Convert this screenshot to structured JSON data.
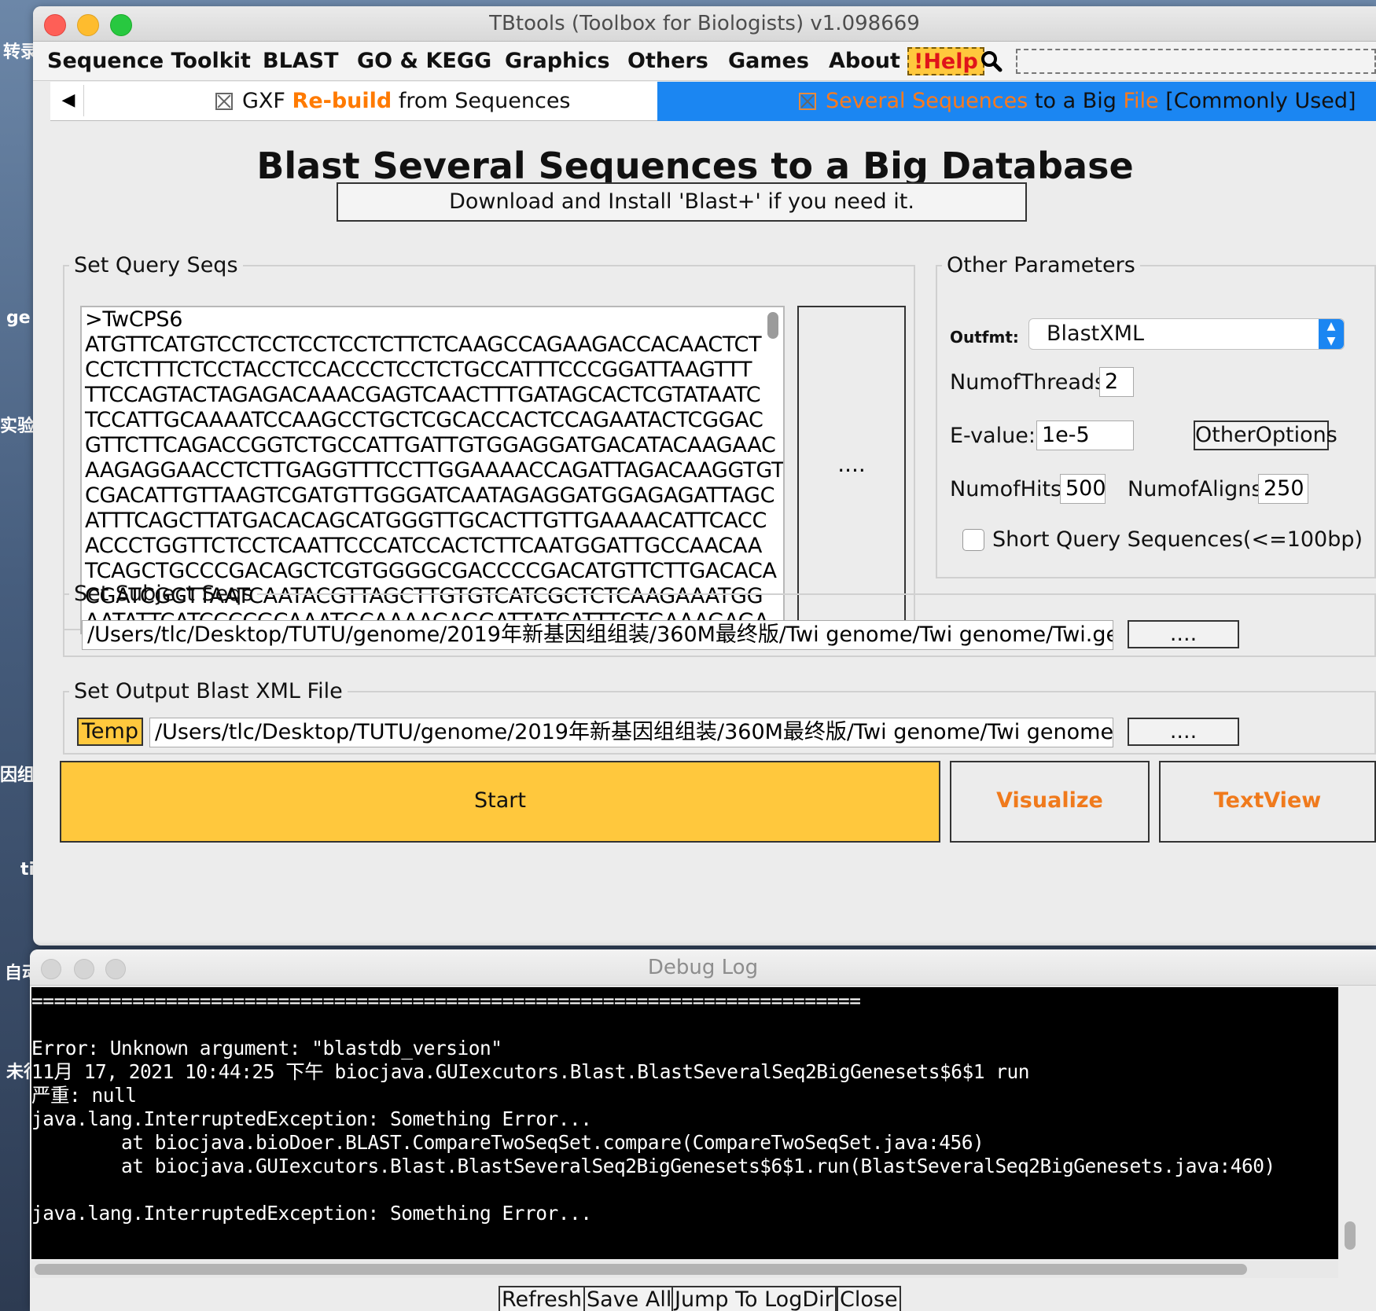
{
  "desktop": {
    "left_labels": [
      "转录",
      "ge",
      "实验",
      "因组",
      "ti",
      "自动",
      "未行"
    ]
  },
  "window": {
    "title": "TBtools (Toolbox for Biologists) v1.098669"
  },
  "menu": {
    "items": [
      "Sequence Toolkit",
      "BLAST",
      "GO & KEGG",
      "Graphics",
      "Others",
      "Games",
      "About"
    ],
    "help": "!Help"
  },
  "tabs": {
    "left": {
      "prefix": "GXF ",
      "highlight": "Re-build",
      "suffix": " from Sequences"
    },
    "right": {
      "part1": "Several Sequences",
      "part2": " to a Big ",
      "part3": "File",
      "part4": " [Commonly Used]"
    }
  },
  "main": {
    "title": "Blast Several Sequences to a Big Database",
    "download_button": "Download and Install 'Blast+' if you need it."
  },
  "query": {
    "legend": "Set Query Seqs",
    "lines": [
      ">TwCPS6",
      "ATGTTCATGTCCTCCTCCTCCTCTTCTCAAGCCAGAAGACCACAACTCT",
      "CCTCTTTCTCCTACCTCCACCCTCCTCTGCCATTTCCCGGATTAAGTTT",
      "TTCCAGTACTAGAGACAAACGAGTCAACTTTGATAGCACTCGTATAATC",
      "TCCATTGCAAAATCCAAGCCTGCTCGCACCACTCCAGAATACTCGGAC",
      "GTTCTTCAGACCGGTCTGCCATTGATTGTGGAGGATGACATACAAGAAC",
      "AAGAGGAACCTCTTGAGGTTTCCTTGGAAAACCAGATTAGACAAGGTGT",
      "CGACATTGTTAAGTCGATGTTGGGATCAATAGAGGATGGAGAGATTAGC",
      "ATTTCAGCTTATGACACAGCATGGGTTGCACTTGTTGAAAACATTCACC",
      "ACCCTGGTTCTCCTCAATTCCCATCCACTCTTCAATGGATTGCCAACAA",
      "TCAGCTGCCCGACAGCTCGTGGGGCGACCCCGACATGTTCTTGACACA",
      "CGATCGGTTAATCAATACGTTAGCTTGTGTCATCGCTCTCAAGAAATGG",
      "AATATTCATCCCCGCAAATGCAAAAGAGGATTATCATTTGTGAAAGAGA"
    ],
    "browse": "...."
  },
  "params": {
    "legend": "Other Parameters",
    "outfmt_label": "Outfmt:",
    "outfmt_value": "BlastXML",
    "threads_label": "NumofThreads:",
    "threads_value": "2",
    "evalue_label": "E-value:",
    "evalue_value": "1e-5",
    "other_options": "OtherOptions",
    "hits_label": "NumofHits:",
    "hits_value": "500",
    "aligns_label": "NumofAligns:",
    "aligns_value": "250",
    "short_query_label": "Short Query Sequences(<=100bp)"
  },
  "subject": {
    "legend": "Set Subject Seqs",
    "path": "/Users/tlc/Desktop/TUTU/genome/2019年新基因组组装/360M最终版/Twi genome/Twi genome/Twi.genome.fa",
    "browse": "...."
  },
  "output": {
    "legend": "Set Output Blast XML File",
    "temp": "Temp",
    "path": "/Users/tlc/Desktop/TUTU/genome/2019年新基因组组装/360M最终版/Twi genome/Twi genome/tps.txt",
    "browse": "...."
  },
  "actions": {
    "start": "Start",
    "visualize": "Visualize",
    "textview": "TextView"
  },
  "debug": {
    "title": "Debug Log",
    "lines": [
      "==========================================================================",
      "",
      "Error: Unknown argument: \"blastdb_version\"",
      "11月 17, 2021 10:44:25 下午 biocjava.GUIexcutors.Blast.BlastSeveralSeq2BigGenesets$6$1 run",
      "严重: null",
      "java.lang.InterruptedException: Something Error...",
      "        at biocjava.bioDoer.BLAST.CompareTwoSeqSet.compare(CompareTwoSeqSet.java:456)",
      "        at biocjava.GUIexcutors.Blast.BlastSeveralSeq2BigGenesets$6$1.run(BlastSeveralSeq2BigGenesets.java:460)",
      "",
      "java.lang.InterruptedException: Something Error..."
    ],
    "buttons": [
      "Refresh",
      "Save All",
      "Jump To LogDir",
      "Close"
    ]
  },
  "colors": {
    "accent_yellow": "#ffc83d",
    "tab_blue": "#1b86f2",
    "orange_text": "#ff7a00",
    "help_red": "#e0141a"
  }
}
